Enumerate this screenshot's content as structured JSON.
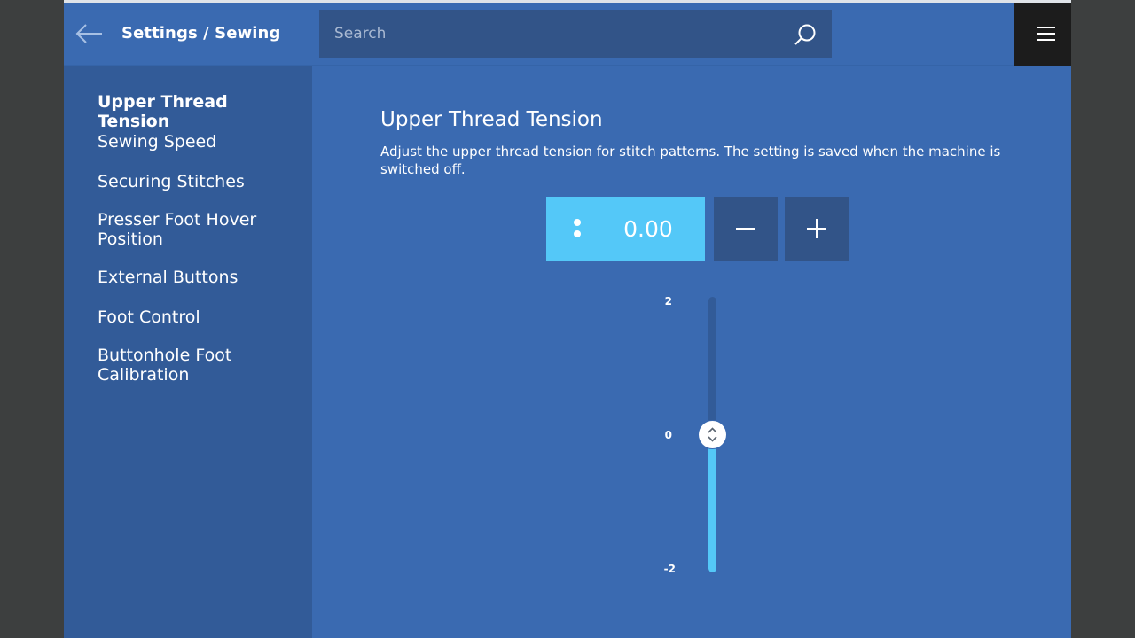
{
  "header": {
    "breadcrumb": "Settings / Sewing",
    "search_placeholder": "Search"
  },
  "icons": {
    "back": "arrow-left-icon",
    "search": "search-icon",
    "menu": "hamburger-menu-icon",
    "more": "vertical-dots-icon",
    "minus": "minus-icon",
    "plus": "plus-icon",
    "slider_handle": "up-down-chevron-icon"
  },
  "sidebar": {
    "items": [
      {
        "label": "Upper Thread Tension",
        "active": true
      },
      {
        "label": "Sewing Speed",
        "active": false
      },
      {
        "label": "Securing Stitches",
        "active": false
      },
      {
        "label": "Presser Foot Hover Position",
        "active": false
      },
      {
        "label": "External Buttons",
        "active": false
      },
      {
        "label": "Foot Control",
        "active": false
      },
      {
        "label": "Buttonhole Foot Calibration",
        "active": false
      }
    ]
  },
  "main": {
    "title": "Upper Thread Tension",
    "description": "Adjust the upper thread tension for stitch patterns. The setting is saved when the machine is switched off.",
    "value_display": "0.00"
  },
  "slider": {
    "max_label": "2",
    "mid_label": "0",
    "min_label": "-2",
    "min": -2,
    "max": 2,
    "value": 0
  },
  "colors": {
    "background": "#3a6ab1",
    "sidebar": "#325b98",
    "accent": "#54c8f8",
    "control": "#325488",
    "menu_button": "#1c1c1c",
    "text": "#ffffff"
  }
}
